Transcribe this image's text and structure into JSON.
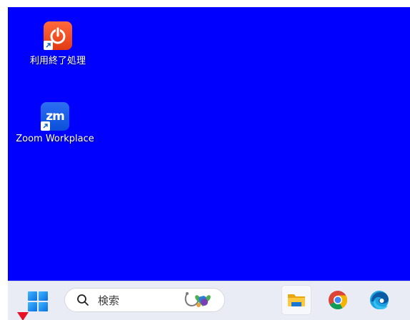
{
  "desktop": {
    "background_color": "#0000fe",
    "icons": [
      {
        "label": "利用終了処理",
        "icon": "power-shutdown-icon",
        "color": "#e23a12"
      },
      {
        "label": "Zoom Workplace",
        "icon": "zoom-icon",
        "color": "#0b4fd9",
        "glyph": "zm"
      }
    ]
  },
  "taskbar": {
    "background_color": "#e9ecf5",
    "start_icon": "windows-start-icon",
    "search": {
      "placeholder": "検索",
      "icon": "search-icon",
      "widget_icon": "search-highlight-stethoscope-icon"
    },
    "apps": [
      {
        "name": "File Explorer",
        "icon": "file-explorer-icon",
        "active": true
      },
      {
        "name": "Google Chrome",
        "icon": "chrome-icon",
        "active": false
      },
      {
        "name": "Microsoft Edge",
        "icon": "edge-icon",
        "active": false
      }
    ]
  }
}
